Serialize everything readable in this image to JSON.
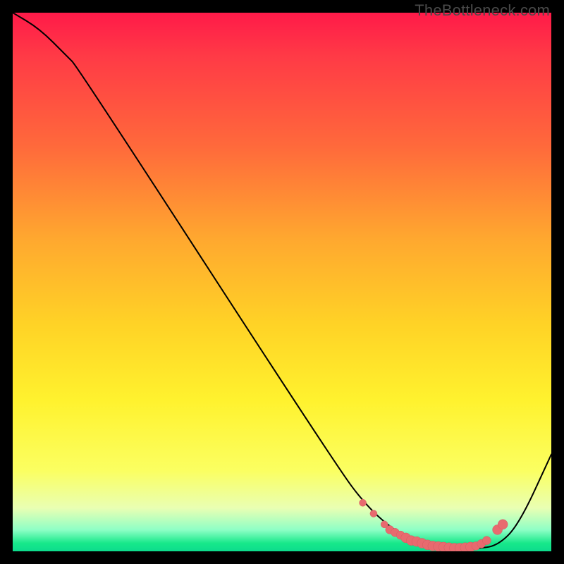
{
  "watermark": "TheBottleneck.com",
  "colors": {
    "curve_stroke": "#000000",
    "dot_fill": "#e86a6f",
    "dot_stroke": "#d35b60"
  },
  "chart_data": {
    "type": "line",
    "title": "",
    "xlabel": "",
    "ylabel": "",
    "xlim": [
      0,
      100
    ],
    "ylim": [
      0,
      100
    ],
    "series": [
      {
        "name": "bottleneck-curve",
        "x": [
          0,
          5,
          10,
          12,
          60,
          66,
          72,
          78,
          82,
          86,
          90,
          94,
          100
        ],
        "y": [
          100,
          97,
          92,
          90,
          16,
          8,
          3,
          1,
          0.5,
          0.5,
          1,
          5,
          18
        ]
      }
    ],
    "markers": {
      "name": "optimal-range-dots",
      "x": [
        65,
        67,
        69,
        70,
        71,
        72,
        73,
        74,
        75,
        76,
        77,
        78,
        79,
        80,
        81,
        82,
        83,
        84,
        85,
        86,
        87,
        88,
        90,
        91
      ],
      "y": [
        9,
        7,
        5,
        4,
        3.5,
        3,
        2.5,
        2,
        1.8,
        1.5,
        1.2,
        1,
        0.9,
        0.8,
        0.7,
        0.6,
        0.6,
        0.7,
        0.8,
        1,
        1.4,
        2,
        4,
        5
      ],
      "r": [
        5,
        5,
        5,
        6,
        6,
        6,
        7,
        7,
        7,
        7,
        7,
        7,
        7,
        7,
        7,
        7,
        7,
        7,
        7,
        6,
        6,
        6,
        7,
        7
      ]
    }
  }
}
